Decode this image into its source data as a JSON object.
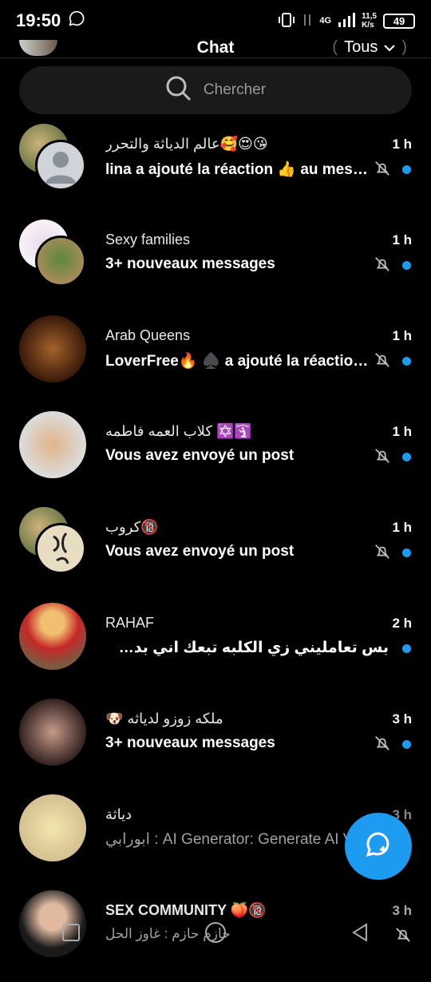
{
  "status": {
    "time": "19:50",
    "net_type": "4G",
    "speed": "11,5",
    "speed_unit": "K/s",
    "battery": "49"
  },
  "header": {
    "title": "Chat",
    "filter_label": "Tous"
  },
  "search": {
    "placeholder": "Chercher"
  },
  "conversations": [
    {
      "name": "عالم الدياثة والتحرر🥰😍😘",
      "time": "1 h",
      "preview": "lina a ajouté la réaction 👍 au mess...",
      "muted": true,
      "unread": true
    },
    {
      "name": "Sexy families",
      "time": "1 h",
      "preview": "3+ nouveaux messages",
      "muted": true,
      "unread": true
    },
    {
      "name": " Arab Queens",
      "time": "1 h",
      "preview": "LoverFree🔥 ♠️ a ajouté la réaction...",
      "muted": true,
      "unread": true
    },
    {
      "name": "كلاب العمه فاطمه ✡️🛐",
      "time": "1 h",
      "preview": "Vous avez envoyé un post",
      "muted": true,
      "unread": true
    },
    {
      "name": "كروب🔞",
      "time": "1 h",
      "preview": "Vous avez envoyé un post",
      "muted": true,
      "unread": true
    },
    {
      "name": "RAHAF",
      "time": "2 h",
      "preview": "بس تعامليني زي الكلبه تبعك اني بدي اصير الكلبه تبع...",
      "muted": false,
      "unread": true
    },
    {
      "name": "🐶 ملكه زوزو  لدياثه",
      "time": "3 h",
      "preview": "3+ nouveaux messages",
      "muted": true,
      "unread": true
    },
    {
      "name": "دياثة",
      "time": "3 h",
      "preview": "ابورابي : AI Generator: Generate AI V...",
      "muted": false,
      "unread": false
    },
    {
      "name": "SEX COMMUNITY 🍑🔞",
      "time": "3 h",
      "preview": "حازم حازم : غاوز الحل",
      "muted": true,
      "unread": false
    }
  ],
  "icons": {
    "mute": "bell-off-icon",
    "search": "search-icon",
    "new_chat": "new-message-icon",
    "dropdown": "chevron-down-icon"
  },
  "colors": {
    "accent": "#1d9bf0",
    "background": "#000000"
  }
}
